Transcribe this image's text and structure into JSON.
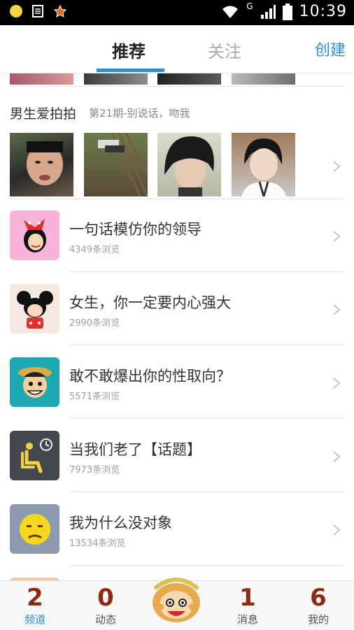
{
  "status_bar": {
    "time": "10:39",
    "network_label": "G",
    "icons": [
      "notification-dot-icon",
      "document-icon",
      "star-badge-icon",
      "wifi-icon",
      "signal-icon",
      "battery-icon"
    ]
  },
  "header": {
    "tabs": [
      {
        "label": "推荐",
        "active": true
      },
      {
        "label": "关注",
        "active": false
      }
    ],
    "create_label": "创建",
    "accent_color": "#2a8ddc"
  },
  "featured": {
    "title": "男生爱拍拍",
    "subtitle": "第21期-别说话，吻我"
  },
  "topics": [
    {
      "title": "一句话模仿你的领导",
      "views": "4349条浏览",
      "icon": "bow-girl-icon"
    },
    {
      "title": "女生，你一定要内心强大",
      "views": "2990条浏览",
      "icon": "mickey-icon"
    },
    {
      "title": "敢不敢爆出你的性取向？",
      "views": "5571条浏览",
      "icon": "pirate-boy-icon"
    },
    {
      "title": "当我们老了【话题】",
      "views": "7973条浏览",
      "icon": "elderly-seat-icon"
    },
    {
      "title": "我为什么没对象",
      "views": "13534条浏览",
      "icon": "sad-face-icon"
    }
  ],
  "bottom_nav": [
    {
      "count": "2",
      "label": "频道",
      "active": true
    },
    {
      "count": "0",
      "label": "动态",
      "active": false
    },
    {
      "count": "1",
      "label": "消息",
      "active": false
    },
    {
      "count": "6",
      "label": "我的",
      "active": false
    }
  ]
}
